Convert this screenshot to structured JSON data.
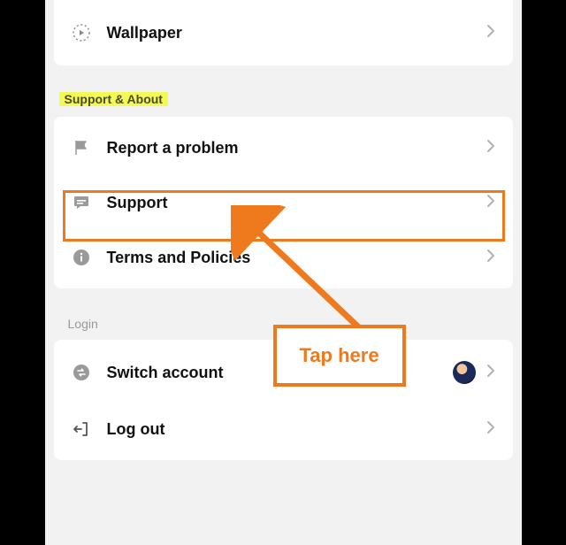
{
  "sections": {
    "top_items": [
      {
        "label": "Wallpaper"
      }
    ],
    "support_header": "Support & About",
    "support_items": [
      {
        "label": "Report a problem"
      },
      {
        "label": "Support"
      },
      {
        "label": "Terms and Policies"
      }
    ],
    "login_header": "Login",
    "login_items": [
      {
        "label": "Switch account"
      },
      {
        "label": "Log out"
      }
    ]
  },
  "annotation": {
    "callout": "Tap here"
  },
  "colors": {
    "accent": "#ee7a1d",
    "highlight": "#f4fa55"
  }
}
